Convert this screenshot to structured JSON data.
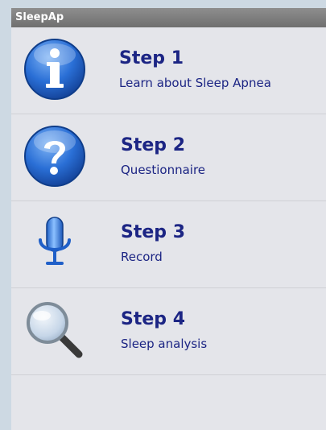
{
  "app": {
    "title": "SleepAp"
  },
  "steps": [
    {
      "title": "Step 1",
      "subtitle": "Learn about Sleep Apnea",
      "icon": "info-icon"
    },
    {
      "title": "Step 2",
      "subtitle": "Questionnaire",
      "icon": "question-icon"
    },
    {
      "title": "Step 3",
      "subtitle": "Record",
      "icon": "microphone-icon"
    },
    {
      "title": "Step 4",
      "subtitle": "Sleep analysis",
      "icon": "magnifier-icon"
    }
  ],
  "colors": {
    "title_bar": "#7f7f7f",
    "background": "#e4e5ea",
    "text": "#1c2584",
    "icon_blue": "#2a6fd6"
  }
}
